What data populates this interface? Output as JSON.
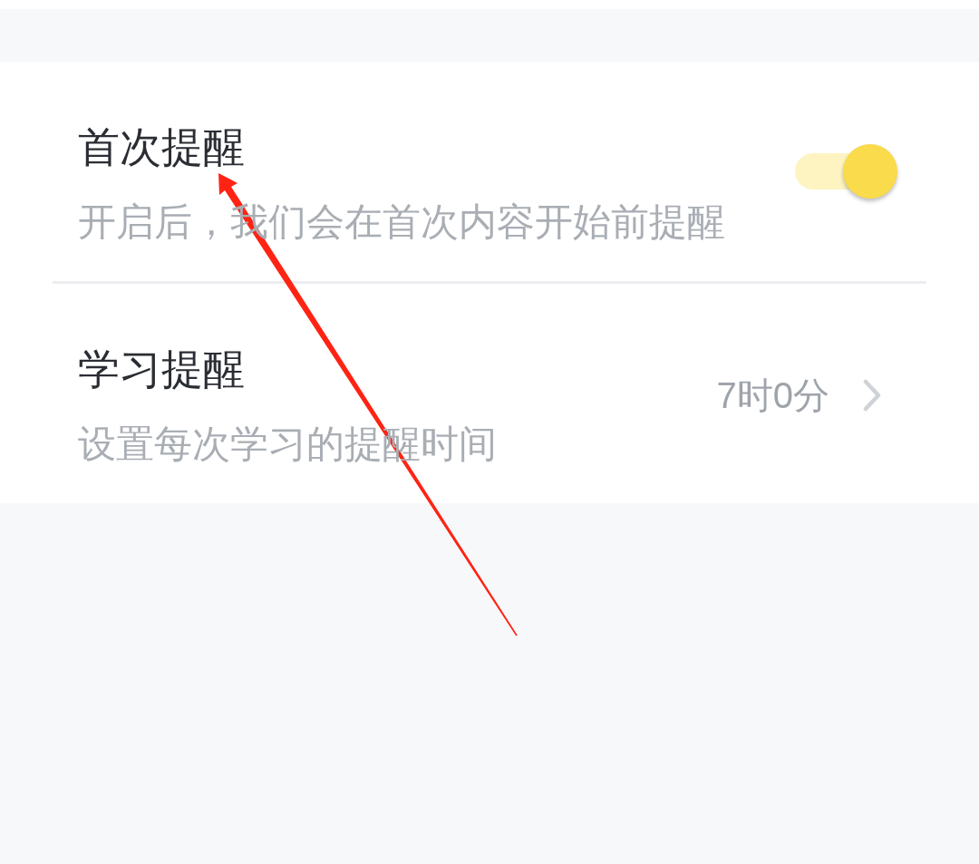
{
  "items": [
    {
      "kind": "toggle",
      "title": "首次提醒",
      "description": "开启后，我们会在首次内容开始前提醒",
      "on": true
    },
    {
      "kind": "value",
      "title": "学习提醒",
      "description": "设置每次学习的提醒时间",
      "value": "7时0分"
    }
  ]
}
